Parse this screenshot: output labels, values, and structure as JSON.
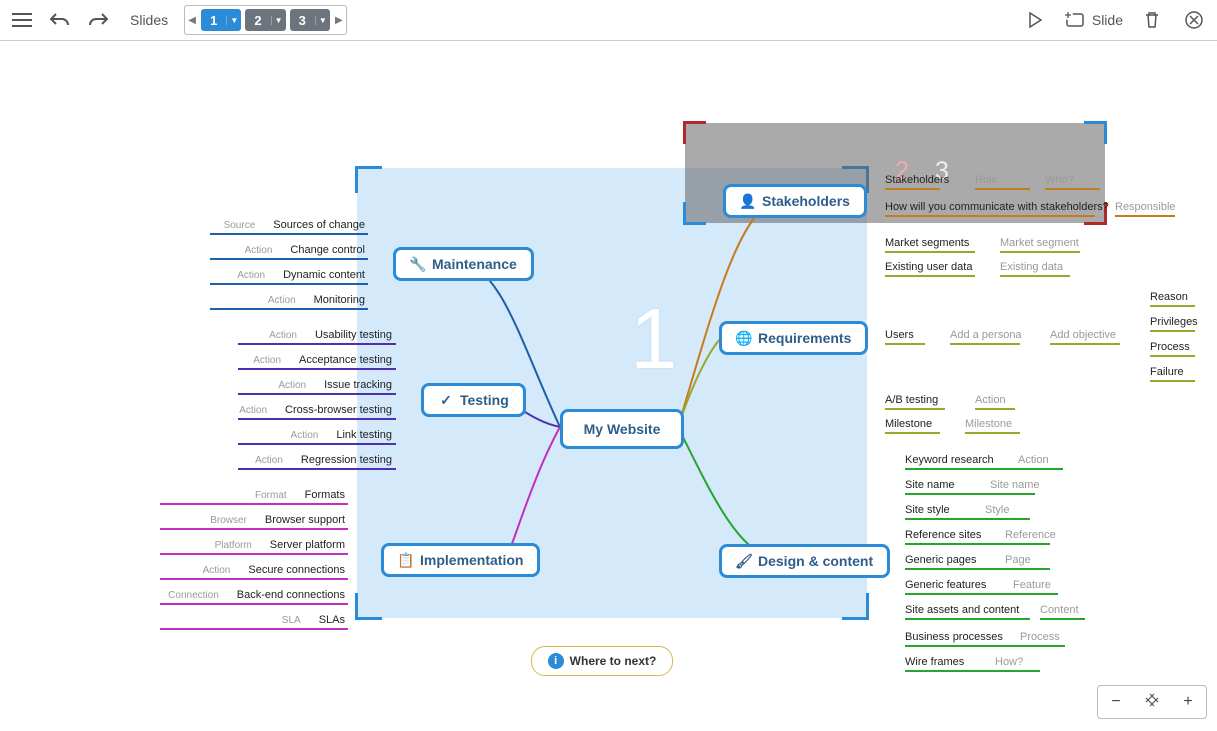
{
  "toolbar": {
    "title": "Slides",
    "slide_btn": "Slide",
    "slides": [
      "1",
      "2",
      "3"
    ],
    "active_slide": 0
  },
  "center": "My Website",
  "where_next": "Where to next?",
  "branches": {
    "maintenance": {
      "label": "Maintenance",
      "leaves": [
        {
          "tag": "Source",
          "val": "Sources of change"
        },
        {
          "tag": "Action",
          "val": "Change control"
        },
        {
          "tag": "Action",
          "val": "Dynamic content"
        },
        {
          "tag": "Action",
          "val": "Monitoring"
        }
      ]
    },
    "testing": {
      "label": "Testing",
      "leaves": [
        {
          "tag": "Action",
          "val": "Usability testing"
        },
        {
          "tag": "Action",
          "val": "Acceptance testing"
        },
        {
          "tag": "Action",
          "val": "Issue tracking"
        },
        {
          "tag": "Action",
          "val": "Cross-browser testing"
        },
        {
          "tag": "Action",
          "val": "Link testing"
        },
        {
          "tag": "Action",
          "val": "Regression testing"
        }
      ]
    },
    "implementation": {
      "label": "Implementation",
      "leaves": [
        {
          "tag": "Format",
          "val": "Formats"
        },
        {
          "tag": "Browser",
          "val": "Browser support"
        },
        {
          "tag": "Platform",
          "val": "Server platform"
        },
        {
          "tag": "Action",
          "val": "Secure connections"
        },
        {
          "tag": "Connection",
          "val": "Back-end connections"
        },
        {
          "tag": "SLA",
          "val": "SLAs"
        }
      ]
    },
    "stakeholders": {
      "label": "Stakeholders",
      "rows": [
        [
          {
            "val": "Stakeholders"
          },
          {
            "val": "Role",
            "ph": true
          },
          {
            "val": "Who?",
            "ph": true
          }
        ],
        [
          {
            "val": "How will you communicate with stakeholders?"
          },
          {
            "val": "Responsible",
            "ph": true
          }
        ]
      ]
    },
    "requirements": {
      "label": "Requirements",
      "groups": {
        "market": [
          {
            "val": "Market segments"
          },
          {
            "val": "Market segment",
            "ph": true
          }
        ],
        "existing": [
          {
            "val": "Existing user data"
          },
          {
            "val": "Existing data",
            "ph": true
          }
        ],
        "users": [
          {
            "val": "Users"
          },
          {
            "val": "Add a persona",
            "ph": true
          },
          {
            "val": "Add objective",
            "ph": true
          }
        ],
        "users_sub": [
          "Reason",
          "Privileges",
          "Process",
          "Failure"
        ],
        "ab": [
          {
            "val": "A/B testing"
          },
          {
            "val": "Action",
            "ph": true
          }
        ],
        "milestone": [
          {
            "val": "Milestone"
          },
          {
            "val": "Milestone",
            "ph": true
          }
        ]
      }
    },
    "design": {
      "label": "Design & content",
      "leaves": [
        {
          "a": "Keyword research",
          "b": "Action",
          "bph": true
        },
        {
          "a": "Site name",
          "b": "Site name",
          "bph": true
        },
        {
          "a": "Site style",
          "b": "Style",
          "bph": true
        },
        {
          "a": "Reference sites",
          "b": "Reference",
          "bph": true
        },
        {
          "a": "Generic pages",
          "b": "Page",
          "bph": true
        },
        {
          "a": "Generic features",
          "b": "Feature",
          "bph": true
        },
        {
          "a": "Site assets and content",
          "b": "Content",
          "bph": true
        },
        {
          "a": "Business processes",
          "b": "Process",
          "bph": true
        },
        {
          "a": "Wire frames",
          "b": "How?",
          "bph": true
        }
      ]
    }
  },
  "zoom": {
    "out": "−",
    "in": "+"
  }
}
